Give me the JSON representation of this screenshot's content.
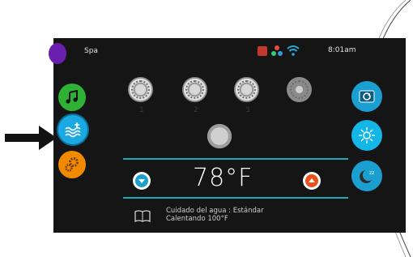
{
  "status_bar": {
    "title": "Spa",
    "time": "8:01am"
  },
  "left_menu": [
    {
      "name": "music",
      "color": "#2eb135"
    },
    {
      "name": "water-care",
      "color": "#1aa9e3",
      "selected": true
    },
    {
      "name": "settings",
      "color": "#f28a00"
    }
  ],
  "right_menu": [
    {
      "name": "flip-screen",
      "color": "#1a9fd0"
    },
    {
      "name": "light",
      "color": "#14b6e6"
    },
    {
      "name": "night-mode",
      "color": "#1a9fd0"
    }
  ],
  "jets": [
    {
      "label": "1"
    },
    {
      "label": "2"
    },
    {
      "label": "3"
    },
    {
      "label": ""
    }
  ],
  "temperature": {
    "value": "78°F"
  },
  "status": {
    "line1": "Cuidado del agua : Estándar",
    "line2": "Calentando 100°F"
  }
}
